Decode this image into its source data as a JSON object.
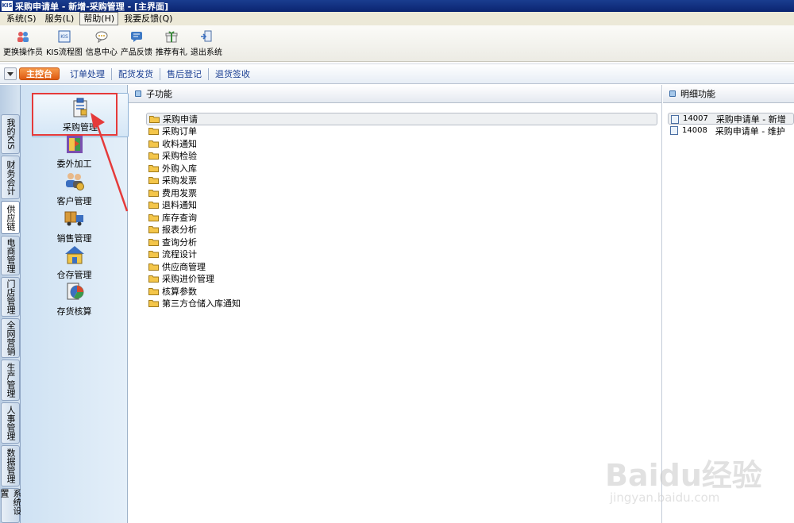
{
  "window": {
    "logo_text": "KIS",
    "title": "采购申请单 - 新增-采购管理 - [主界面]"
  },
  "menubar": {
    "items": [
      {
        "label": "系统(S)",
        "active": false
      },
      {
        "label": "服务(L)",
        "active": false
      },
      {
        "label": "帮助(H)",
        "active": true
      },
      {
        "label": "我要反馈(Q)",
        "active": false
      }
    ]
  },
  "toolbar": {
    "items": [
      {
        "label": "更换操作员",
        "icon": "change-operator-icon"
      },
      {
        "label": "KIS流程图",
        "icon": "flowchart-icon"
      },
      {
        "label": "信息中心",
        "icon": "info-center-icon"
      },
      {
        "label": "产品反馈",
        "icon": "feedback-icon"
      },
      {
        "label": "推荐有礼",
        "icon": "gift-icon"
      },
      {
        "label": "退出系统",
        "icon": "exit-icon"
      }
    ]
  },
  "navtabs": {
    "home": "主控台",
    "items": [
      "订单处理",
      "配货发货",
      "售后登记",
      "退货签收"
    ]
  },
  "vtabs": {
    "items": [
      {
        "label": "我的KIS",
        "active": false
      },
      {
        "label": "财务会计",
        "active": false
      },
      {
        "label": "供应链",
        "active": true
      },
      {
        "label": "电商管理",
        "active": false
      },
      {
        "label": "门店管理",
        "active": false
      },
      {
        "label": "全网营销",
        "active": false
      },
      {
        "label": "生产管理",
        "active": false
      },
      {
        "label": "人事管理",
        "active": false
      },
      {
        "label": "数据管理",
        "active": false
      },
      {
        "label": "系统设置",
        "active": false
      }
    ]
  },
  "modules": {
    "items": [
      {
        "label": "采购管理",
        "icon": "purchase-management-icon",
        "selected": true
      },
      {
        "label": "委外加工",
        "icon": "outsourcing-icon",
        "selected": false
      },
      {
        "label": "客户管理",
        "icon": "customer-management-icon",
        "selected": false
      },
      {
        "label": "销售管理",
        "icon": "sales-truck-icon",
        "selected": false
      },
      {
        "label": "仓存管理",
        "icon": "warehouse-icon",
        "selected": false
      },
      {
        "label": "存货核算",
        "icon": "inventory-accounting-icon",
        "selected": false
      }
    ]
  },
  "subfunctions": {
    "title": "子功能",
    "items": [
      {
        "label": "采购申请",
        "selected": true
      },
      {
        "label": "采购订单",
        "selected": false
      },
      {
        "label": "收料通知",
        "selected": false
      },
      {
        "label": "采购检验",
        "selected": false
      },
      {
        "label": "外购入库",
        "selected": false
      },
      {
        "label": "采购发票",
        "selected": false
      },
      {
        "label": "费用发票",
        "selected": false
      },
      {
        "label": "退料通知",
        "selected": false
      },
      {
        "label": "库存查询",
        "selected": false
      },
      {
        "label": "报表分析",
        "selected": false
      },
      {
        "label": "查询分析",
        "selected": false
      },
      {
        "label": "流程设计",
        "selected": false
      },
      {
        "label": "供应商管理",
        "selected": false
      },
      {
        "label": "采购进价管理",
        "selected": false
      },
      {
        "label": "核算参数",
        "selected": false
      },
      {
        "label": "第三方仓储入库通知",
        "selected": false
      }
    ]
  },
  "details": {
    "title": "明细功能",
    "items": [
      {
        "code": "14007",
        "name": "采购申请单 - 新增",
        "selected": true
      },
      {
        "code": "14008",
        "name": "采购申请单 - 维护",
        "selected": false
      }
    ]
  },
  "watermark": {
    "main": "Baidu经验",
    "sub": "jingyan.baidu.com"
  },
  "colors": {
    "titlebar": "#0a2470",
    "home_tab": "#de5a12",
    "highlight": "#e53a3a",
    "folder": "#f4c64a"
  }
}
